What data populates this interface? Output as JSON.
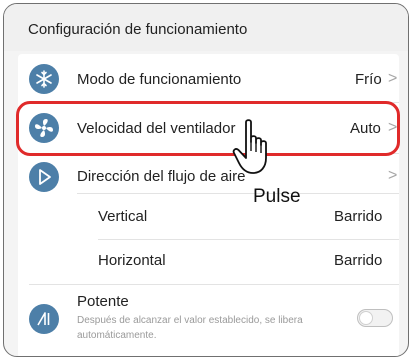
{
  "header": {
    "title": "Configuración de funcionamiento"
  },
  "rows": [
    {
      "label": "Modo de funcionamiento",
      "value": "Frío",
      "chevron": ">",
      "icon": "snowflake-sun-icon"
    },
    {
      "label": "Velocidad del ventilador",
      "value": "Auto",
      "chevron": ">",
      "icon": "fan-icon"
    },
    {
      "label": "Dirección del flujo de aire",
      "value": "",
      "chevron": ">",
      "icon": "airflow-direction-icon"
    },
    {
      "label": "Vertical",
      "value": "Barrido"
    },
    {
      "label": "Horizontal",
      "value": "Barrido"
    },
    {
      "label": "Potente",
      "description": "Después de alcanzar el valor establecido, se libera automáticamente.",
      "icon": "powerful-icon",
      "toggle_on": false
    }
  ],
  "annotation": {
    "text": "Pulse",
    "icon": "pointing-hand-icon"
  },
  "colors": {
    "icon_bg": "#4d7fa8",
    "highlight": "#e02a2a"
  }
}
